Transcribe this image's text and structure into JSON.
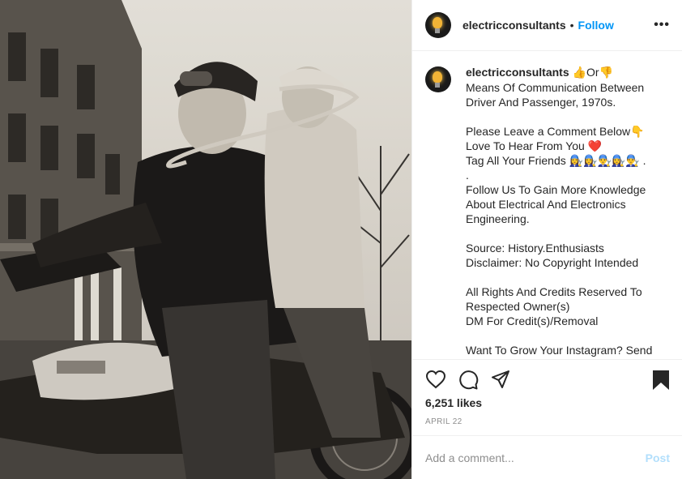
{
  "post": {
    "username": "electricconsultants",
    "separator": "•",
    "follow_label": "Follow",
    "more_label": "•••"
  },
  "caption": {
    "username": "electricconsultants",
    "emoji_thumbs_up": "👍",
    "or_text": "Or",
    "emoji_thumbs_down": "👎",
    "lines": [
      "Means Of Communication Between",
      "Driver And Passenger, 1970s.",
      "",
      "Please Leave a Comment Below👇",
      "Love To Hear From You ❤️",
      "Tag All Your Friends 👩‍🔧👩‍🔧👨‍🔧👩‍🔧👨‍🔧 .",
      ".",
      "Follow Us To Gain More Knowledge",
      "About Electrical And Electronics",
      "Engineering.",
      "",
      "Source: History.Enthusiasts",
      "Disclaimer: No Copyright Intended",
      "",
      "All Rights And Credits Reserved To",
      "Respected Owner(s)",
      "DM For Credit(s)/Removal",
      "",
      "Want To Grow Your Instagram? Send"
    ]
  },
  "actions": {
    "like_icon": "heart-icon",
    "comment_icon": "comment-icon",
    "share_icon": "share-icon",
    "save_icon": "bookmark-icon"
  },
  "likes_text": "6,251 likes",
  "date_text": "APRIL 22",
  "comment": {
    "placeholder": "Add a comment...",
    "post_label": "Post"
  },
  "colors": {
    "accent": "#0095f6",
    "post_disabled": "#b2dffc",
    "heart": "#e0245e"
  }
}
